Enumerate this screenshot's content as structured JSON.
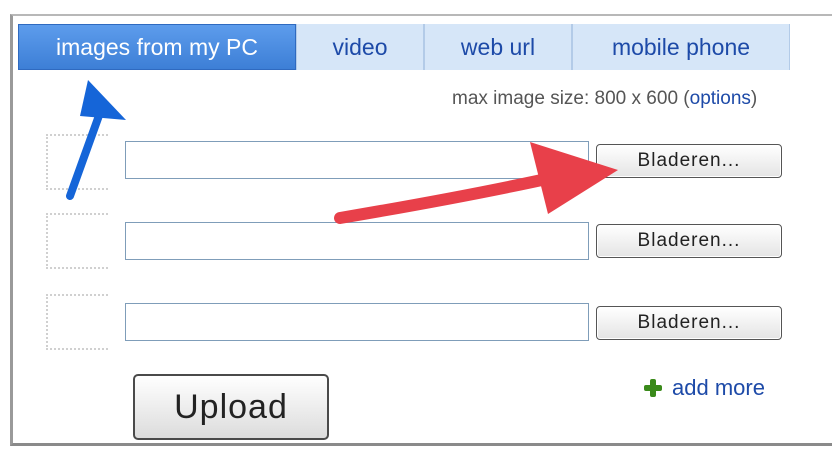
{
  "tabs": [
    {
      "label": "images from my PC",
      "active": true
    },
    {
      "label": "video",
      "active": false
    },
    {
      "label": "web url",
      "active": false
    },
    {
      "label": "mobile phone",
      "active": false
    }
  ],
  "hint": {
    "prefix": "max image size: 800 x 600 (",
    "options_link": "options",
    "suffix": ")"
  },
  "file_rows": [
    {
      "value": "",
      "browse_label": "Bladeren..."
    },
    {
      "value": "",
      "browse_label": "Bladeren..."
    },
    {
      "value": "",
      "browse_label": "Bladeren..."
    }
  ],
  "upload_label": "Upload",
  "add_more_label": "add more",
  "colors": {
    "active_tab": "#4a8ee0",
    "inactive_tab": "#d6e6f8",
    "link": "#1d4aa8",
    "annotation_blue": "#1565d8",
    "annotation_red": "#e8404a"
  }
}
